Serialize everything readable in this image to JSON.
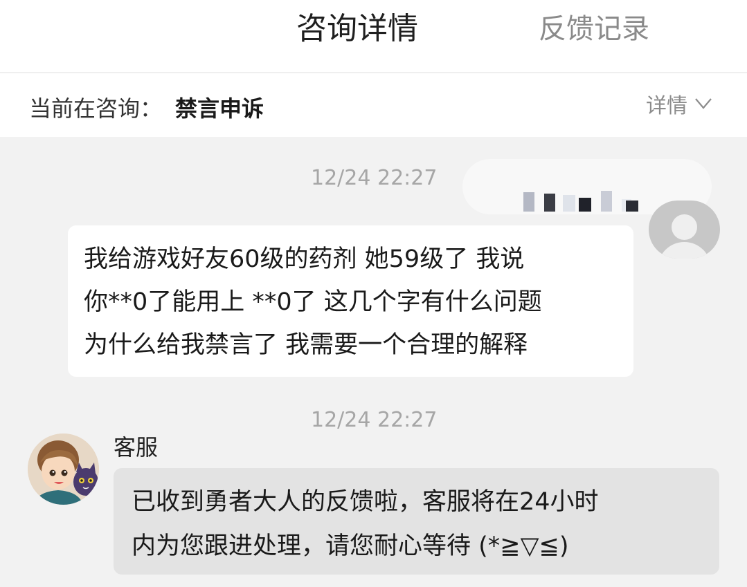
{
  "header": {
    "tabs": [
      {
        "label": "咨询详情",
        "active": true
      },
      {
        "label": "反馈记录",
        "active": false
      }
    ]
  },
  "consult_bar": {
    "prefix": "当前在咨询：",
    "topic": "禁言申诉",
    "detail_label": "详情"
  },
  "messages": [
    {
      "timestamp": "12/24 22:27",
      "sender": "user",
      "lines": [
        "我给游戏好友60级的药剂 她59级了 我说",
        "你**0了能用上 **0了 这几个字有什么问题",
        "为什么给我禁言了 我需要一个合理的解释"
      ]
    },
    {
      "timestamp": "12/24 22:27",
      "sender_name": "客服",
      "lines": [
        "已收到勇者大人的反馈啦，客服将在24小时",
        "内为您跟进处理，请您耐心等待 (*≧▽≦)"
      ]
    }
  ],
  "colors": {
    "page_bg": "#f2f2f2",
    "user_bubble": "#ffffff",
    "agent_bubble": "#e3e3e3",
    "timestamp": "#a6a6a6"
  }
}
